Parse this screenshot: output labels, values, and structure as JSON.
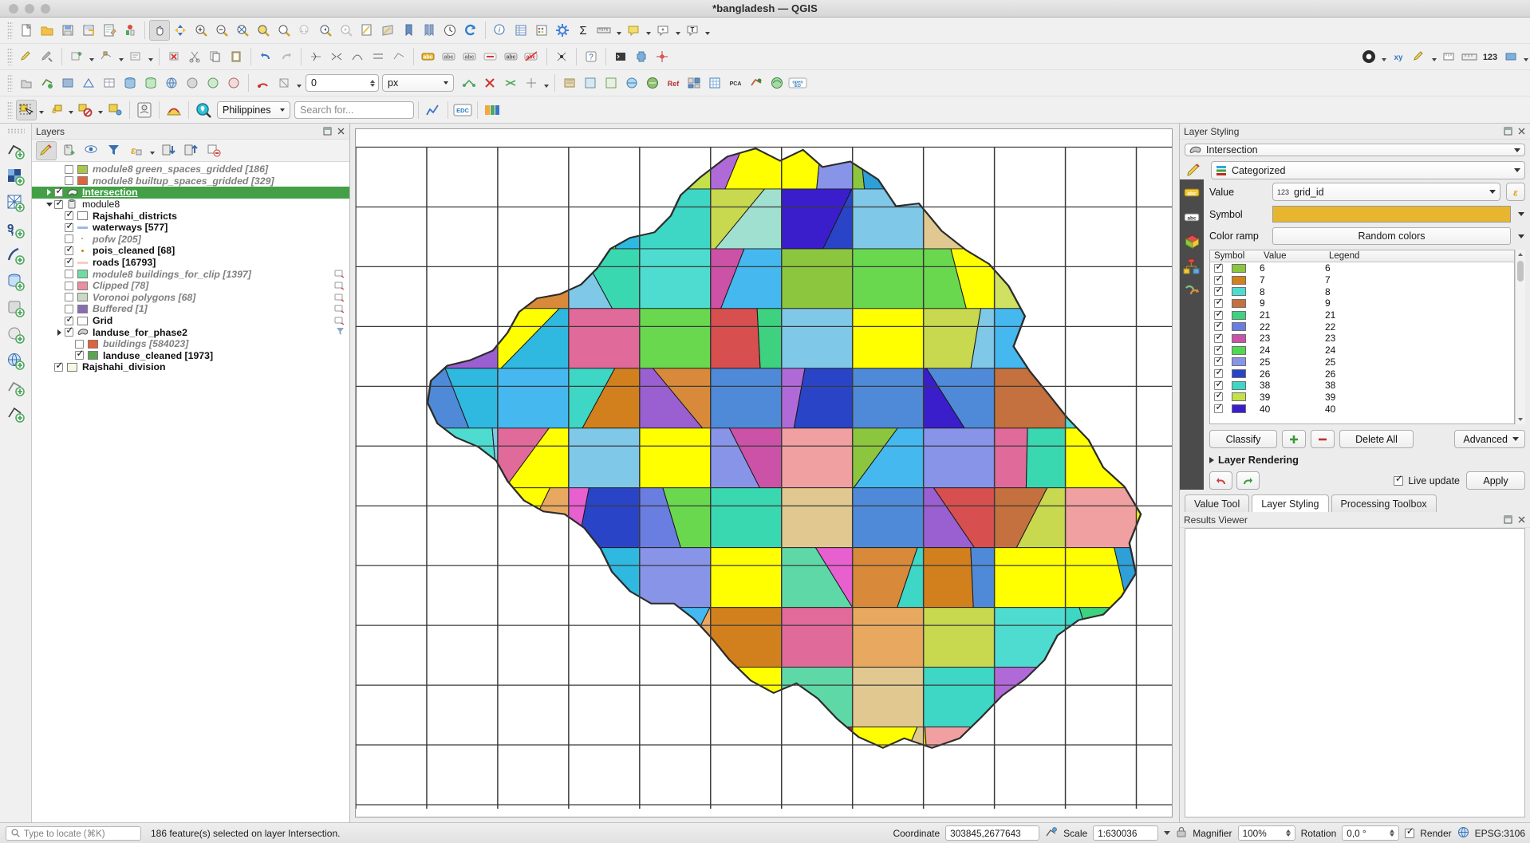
{
  "window": {
    "title": "*bangladesh — QGIS"
  },
  "toolbars": {
    "row1_icons": [
      "new-project-icon",
      "open-project-icon",
      "save-project-icon",
      "save-project-as-icon",
      "new-print-layout-icon",
      "style-manager-icon",
      "pan-map-icon",
      "pan-to-selection-icon",
      "zoom-in-icon",
      "zoom-out-icon",
      "zoom-full-icon",
      "zoom-to-selection-icon",
      "zoom-to-layer-icon",
      "zoom-native-icon",
      "zoom-last-icon",
      "zoom-next-icon",
      "new-map-view-icon",
      "new-3d-map-view-icon",
      "refresh-bookmark-icon",
      "show-bookmarks-icon",
      "temporal-controller-icon",
      "refresh-icon",
      "identify-features-icon",
      "open-attribute-table-icon",
      "field-calculator-icon",
      "processing-toolbox-icon",
      "statistical-summary-icon",
      "measure-line-icon",
      "measure-caret",
      "show-map-tips-icon",
      "new-map-tip-caret",
      "annotation-icon",
      "annotation-caret",
      "text-annotation-icon",
      "text-annotation-caret"
    ],
    "row2_icons": [
      "toggle-editing-icon",
      "save-layer-edits-icon",
      "add-feature-icon",
      "add-feature-caret",
      "vertex-tool-icon",
      "vertex-tool-caret",
      "modify-attributes-icon",
      "modify-caret",
      "delete-selected-icon",
      "cut-features-icon",
      "copy-features-icon",
      "paste-features-icon",
      "undo-icon",
      "redo-icon",
      "split-features-icon",
      "merge-features-icon",
      "reshape-features-icon",
      "offset-curve-icon",
      "add-label-icon",
      "move-label-icon",
      "rotate-label-icon",
      "change-label-icon",
      "pin-labels-icon",
      "show-hide-labels-icon",
      "highlight-pinned-icon",
      "help-icon",
      "python-console-icon",
      "plugin-manager-icon",
      "vertex-edit-icon"
    ],
    "row3_icons": [
      "select-features-icon",
      "select-polygon-icon",
      "select-freehand-icon",
      "select-radius-icon",
      "deselect-icon",
      "select-all-icon",
      "invert-selection-icon",
      "select-by-expression-icon",
      "select-by-value-icon",
      "georeferencer-icon",
      "raster-calculator-icon",
      "mesh-calculator-icon",
      "network-analysis-icon",
      "openstreetmap-icon",
      "db-manager-icon",
      "ref-icon",
      "grass-icon",
      "grid-icon",
      "pca-icon",
      "semi-automatic-icon",
      "eo-icon",
      "open-eo-icon",
      "snapping-icon",
      "snapping-caret",
      "advanced-digitizing-icon"
    ],
    "row4_icons": [
      "select-features-by-area-icon",
      "select-caret",
      "select-value-icon",
      "select-value-caret",
      "deselect-all-icon",
      "deselect-caret",
      "select-all-features-icon",
      "identify-icon",
      "map-theme-icon",
      "zoom-locator-icon",
      "chart-icon",
      "edc-icon",
      "color-icon"
    ],
    "snap_units": "px",
    "snap_tolerance": "0",
    "locator_filter": "Philippines",
    "search_placeholder": "Search for..."
  },
  "layers_panel": {
    "title": "Layers",
    "toolbar_icons": [
      "open-layer-styling-icon",
      "add-group-icon",
      "manage-visibility-icon",
      "filter-legend-icon",
      "expression-filter-icon",
      "expand-all-icon",
      "collapse-all-icon",
      "remove-layer-icon"
    ],
    "items": [
      {
        "label": "module8 green_spaces_gridded [186]",
        "checked": false,
        "style": "italic",
        "indent": 2,
        "swatch": "#a8c64a",
        "swatch_type": "fill",
        "expander": "none"
      },
      {
        "label": "module8 builtup_spaces_gridded [329]",
        "checked": false,
        "style": "italic",
        "indent": 2,
        "swatch": "#e0633c",
        "swatch_type": "fill",
        "expander": "none"
      },
      {
        "label": "Intersection",
        "checked": true,
        "style": "selected",
        "indent": 1,
        "swatch": "",
        "swatch_type": "polygon-layer-icon",
        "expander": "right"
      },
      {
        "label": "module8",
        "checked": true,
        "style": "normal",
        "indent": 1,
        "swatch": "",
        "swatch_type": "geopackage-icon",
        "expander": "down"
      },
      {
        "label": "Rajshahi_districts",
        "checked": true,
        "style": "bold",
        "indent": 2,
        "swatch": "#ffffff",
        "swatch_type": "fill",
        "expander": "none"
      },
      {
        "label": "waterways [577]",
        "checked": true,
        "style": "bold",
        "indent": 2,
        "swatch": "#9db8e8",
        "swatch_type": "line",
        "expander": "none"
      },
      {
        "label": "pofw [205]",
        "checked": false,
        "style": "italic",
        "indent": 2,
        "swatch": "#9a9a9a",
        "swatch_type": "dot-grey",
        "expander": "none"
      },
      {
        "label": "pois_cleaned [68]",
        "checked": true,
        "style": "bold",
        "indent": 2,
        "swatch": "#c07f1e",
        "swatch_type": "dot",
        "expander": "none"
      },
      {
        "label": "roads [16793]",
        "checked": true,
        "style": "bold",
        "indent": 2,
        "swatch": "#f6cfc2",
        "swatch_type": "line",
        "expander": "none"
      },
      {
        "label": "module8 buildings_for_clip [1397]",
        "checked": false,
        "style": "italic",
        "indent": 2,
        "swatch": "#6fdda1",
        "swatch_type": "fill",
        "expander": "none",
        "tail": "edit-pencil-icon"
      },
      {
        "label": "Clipped [78]",
        "checked": false,
        "style": "italic",
        "indent": 2,
        "swatch": "#e8909f",
        "swatch_type": "fill",
        "expander": "none",
        "tail": "edit-pencil-icon"
      },
      {
        "label": "Voronoi polygons [68]",
        "checked": false,
        "style": "italic",
        "indent": 2,
        "swatch": "#c9d9c4",
        "swatch_type": "fill",
        "expander": "none",
        "tail": "edit-pencil-icon"
      },
      {
        "label": "Buffered [1]",
        "checked": false,
        "style": "italic",
        "indent": 2,
        "swatch": "#8a6bb5",
        "swatch_type": "fill",
        "expander": "none",
        "tail": "edit-pencil-icon"
      },
      {
        "label": "Grid",
        "checked": true,
        "style": "bold",
        "indent": 2,
        "swatch": "#ffffff",
        "swatch_type": "fill",
        "expander": "none",
        "tail": "edit-pencil-icon"
      },
      {
        "label": "landuse_for_phase2",
        "checked": true,
        "style": "bold",
        "indent": 2,
        "swatch": "",
        "swatch_type": "polygon-layer-icon",
        "expander": "right",
        "tail": "filter-icon"
      },
      {
        "label": "buildings [584023]",
        "checked": false,
        "style": "italic",
        "indent": 3,
        "swatch": "#e0633c",
        "swatch_type": "fill",
        "expander": "none"
      },
      {
        "label": "landuse_cleaned [1973]",
        "checked": true,
        "style": "bold",
        "indent": 3,
        "swatch": "#5aa552",
        "swatch_type": "fill",
        "expander": "none"
      },
      {
        "label": "Rajshahi_division",
        "checked": true,
        "style": "bold",
        "indent": 1,
        "swatch": "#f7f7e3",
        "swatch_type": "fill",
        "expander": "none"
      }
    ]
  },
  "layer_styling": {
    "title": "Layer Styling",
    "layer_name": "Intersection",
    "renderer": "Categorized",
    "value_label": "Value",
    "value_field": "grid_id",
    "value_field_prefix": "123",
    "symbol_label": "Symbol",
    "symbol_color": "#e8b62e",
    "colorramp_label": "Color ramp",
    "colorramp_value": "Random colors",
    "side_icons": [
      "paintbrush-icon",
      "labels-abc-icon",
      "masks-abc-icon",
      "3d-view-icon",
      "diagrams-icon",
      "actions-icon"
    ],
    "table_headers": [
      "Symbol",
      "Value",
      "Legend"
    ],
    "classes": [
      {
        "checked": true,
        "color": "#8cc63f",
        "value": "6",
        "legend": "6"
      },
      {
        "checked": true,
        "color": "#d2801e",
        "value": "7",
        "legend": "7"
      },
      {
        "checked": true,
        "color": "#4fdcd0",
        "value": "8",
        "legend": "8"
      },
      {
        "checked": true,
        "color": "#c4713f",
        "value": "9",
        "legend": "9"
      },
      {
        "checked": true,
        "color": "#3ed17f",
        "value": "21",
        "legend": "21"
      },
      {
        "checked": true,
        "color": "#6a7de0",
        "value": "22",
        "legend": "22"
      },
      {
        "checked": true,
        "color": "#cc52a8",
        "value": "23",
        "legend": "23"
      },
      {
        "checked": true,
        "color": "#4fd94f",
        "value": "24",
        "legend": "24"
      },
      {
        "checked": true,
        "color": "#8894e8",
        "value": "25",
        "legend": "25"
      },
      {
        "checked": true,
        "color": "#2a44c8",
        "value": "26",
        "legend": "26"
      },
      {
        "checked": true,
        "color": "#3ed6c4",
        "value": "38",
        "legend": "38"
      },
      {
        "checked": true,
        "color": "#c4e04a",
        "value": "39",
        "legend": "39"
      },
      {
        "checked": true,
        "color": "#3a1ecc",
        "value": "40",
        "legend": "40"
      }
    ],
    "buttons": {
      "classify": "Classify",
      "add": "add-class-icon",
      "remove": "remove-class-icon",
      "delete_all": "Delete All",
      "advanced": "Advanced"
    },
    "layer_rendering": "Layer Rendering",
    "live_update": "Live update",
    "live_update_checked": true,
    "apply": "Apply",
    "undo_icon": "undo-icon",
    "redo_icon": "redo-icon"
  },
  "dock_tabs": [
    {
      "label": "Value Tool",
      "active": false
    },
    {
      "label": "Layer Styling",
      "active": true
    },
    {
      "label": "Processing Toolbox",
      "active": false
    }
  ],
  "results_viewer": {
    "title": "Results Viewer"
  },
  "statusbar": {
    "locate_placeholder": "Type to locate (⌘K)",
    "message": "186 feature(s) selected on layer Intersection.",
    "coordinate_label": "Coordinate",
    "coordinate_value": "303845,2677643",
    "scale_label": "Scale",
    "scale_value": "1:630036",
    "magnifier_label": "Magnifier",
    "magnifier_value": "100%",
    "rotation_label": "Rotation",
    "rotation_value": "0,0 °",
    "render_label": "Render",
    "render_checked": true,
    "crs_label": "EPSG:3106"
  }
}
